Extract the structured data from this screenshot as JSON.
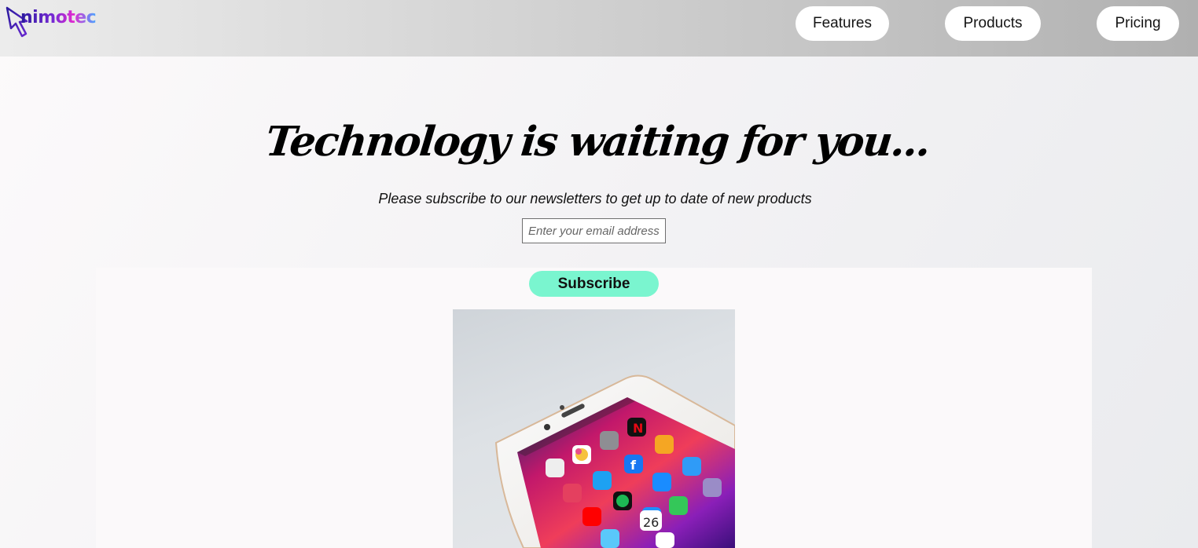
{
  "header": {
    "logo_text": "nimotec",
    "nav": [
      {
        "label": "Features"
      },
      {
        "label": "Products"
      },
      {
        "label": "Pricing"
      }
    ]
  },
  "hero": {
    "title": "Technology is waiting for you...",
    "subtitle": "Please subscribe to our newsletters to get up to date of new products",
    "email_placeholder": "Enter your email address",
    "subscribe_label": "Subscribe"
  },
  "image": {
    "subject": "smartphone-with-app-icons",
    "calendar_day": "26"
  },
  "colors": {
    "accent": "#7af5cf",
    "logo_gradient": [
      "#2a1a9e",
      "#e12ad0",
      "#4aa6ff"
    ]
  }
}
